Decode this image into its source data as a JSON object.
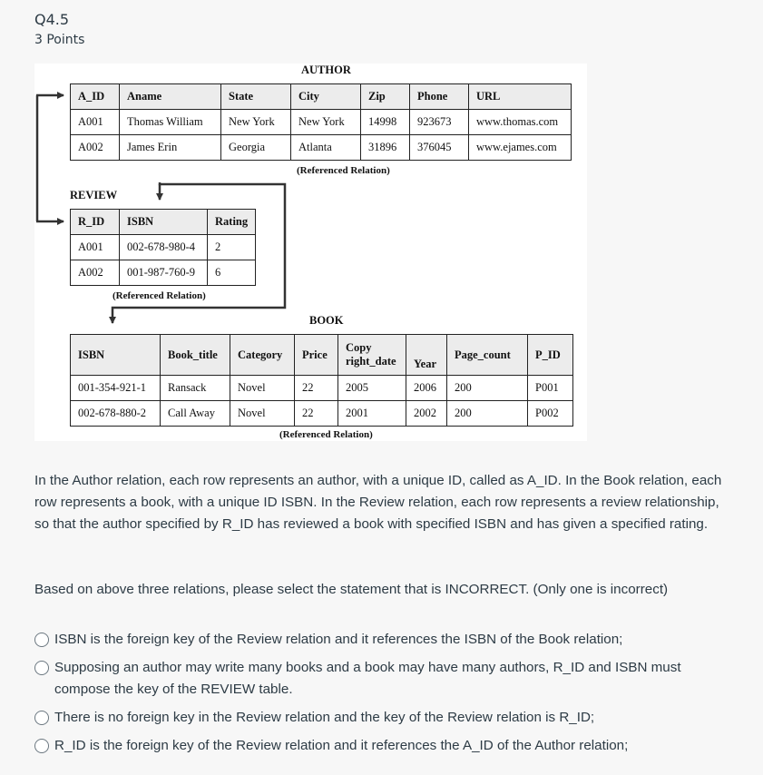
{
  "question": {
    "title": "Q4.5",
    "points": "3 Points"
  },
  "figure": {
    "author": {
      "label": "AUTHOR",
      "columns": [
        "A_ID",
        "Aname",
        "State",
        "City",
        "Zip",
        "Phone",
        "URL"
      ],
      "rows": [
        [
          "A001",
          "Thomas William",
          "New York",
          "New York",
          "14998",
          "923673",
          "www.thomas.com"
        ],
        [
          "A002",
          "James Erin",
          "Georgia",
          "Atlanta",
          "31896",
          "376045",
          "www.ejames.com"
        ]
      ],
      "note": "(Referenced Relation)"
    },
    "review": {
      "label": "REVIEW",
      "columns": [
        "R_ID",
        "ISBN",
        "Rating"
      ],
      "rows": [
        [
          "A001",
          "002-678-980-4",
          "2"
        ],
        [
          "A002",
          "001-987-760-9",
          "6"
        ]
      ],
      "note": "(Referenced Relation)"
    },
    "book": {
      "label": "BOOK",
      "columns": [
        "ISBN",
        "Book_title",
        "Category",
        "Price",
        "Copy right_date",
        "Year",
        "Page_count",
        "P_ID"
      ],
      "rows": [
        [
          "001-354-921-1",
          "Ransack",
          "Novel",
          "22",
          "2005",
          "2006",
          "200",
          "P001"
        ],
        [
          "002-678-880-2",
          "Call Away",
          "Novel",
          "22",
          "2001",
          "2002",
          "200",
          "P002"
        ]
      ],
      "note": "(Referenced Relation)"
    }
  },
  "description": "In the Author relation, each row represents an author, with a unique ID, called as A_ID. In the Book relation, each row represents a book, with a unique ID ISBN. In the Review relation, each row represents a review relationship, so that the author specified by R_ID has reviewed a book with specified ISBN and has given a specified rating.",
  "prompt": "Based on above three relations, please select the statement that is INCORRECT. (Only one is incorrect)",
  "options": [
    {
      "label": "ISBN is the foreign key of the Review relation and it references the ISBN of the Book relation;",
      "selected": false
    },
    {
      "label": "Supposing an author may write many books and a book may have many authors, R_ID and ISBN must compose the key of the REVIEW table.",
      "selected": false
    },
    {
      "label": "There is no foreign key in the Review relation and the key of the Review relation is R_ID;",
      "selected": false
    },
    {
      "label": "R_ID is the foreign key of the Review relation and it references the A_ID of the Author relation;",
      "selected": false
    }
  ]
}
